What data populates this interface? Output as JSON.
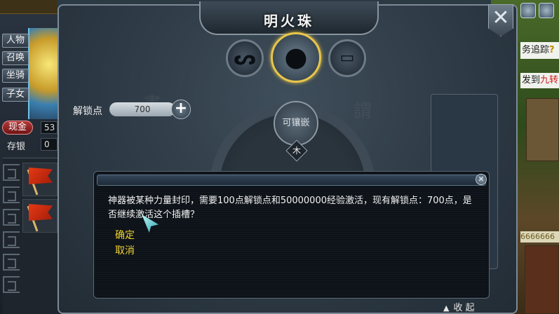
{
  "window": {
    "title": "明火珠",
    "unlock_label": "解锁点",
    "unlock_value": "700",
    "plus": "+",
    "inlay_label": "可镶嵌",
    "element": "木",
    "collapse": "收 起",
    "close": "✕"
  },
  "left": {
    "tabs": [
      "人物",
      "召唤",
      "坐骑",
      "子女"
    ],
    "cash_label": "现金",
    "cash_value": "53",
    "savings_label": "存银",
    "savings_value": "0"
  },
  "right": {
    "track": "务追踪",
    "track_q": "?",
    "goto_prefix": "发到",
    "goto_place": "九转",
    "numbers": "6666666"
  },
  "dialog": {
    "message": "神器被某种力量封印，需要100点解锁点和50000000经验激活，现有解锁点：700点，是否继续激活这个插槽？",
    "confirm": "确定",
    "cancel": "取消",
    "close": "✕"
  },
  "colors": {
    "option_text": "#f0d230",
    "selected_orb": "#e8c64a",
    "cash_badge": "#b53838"
  }
}
